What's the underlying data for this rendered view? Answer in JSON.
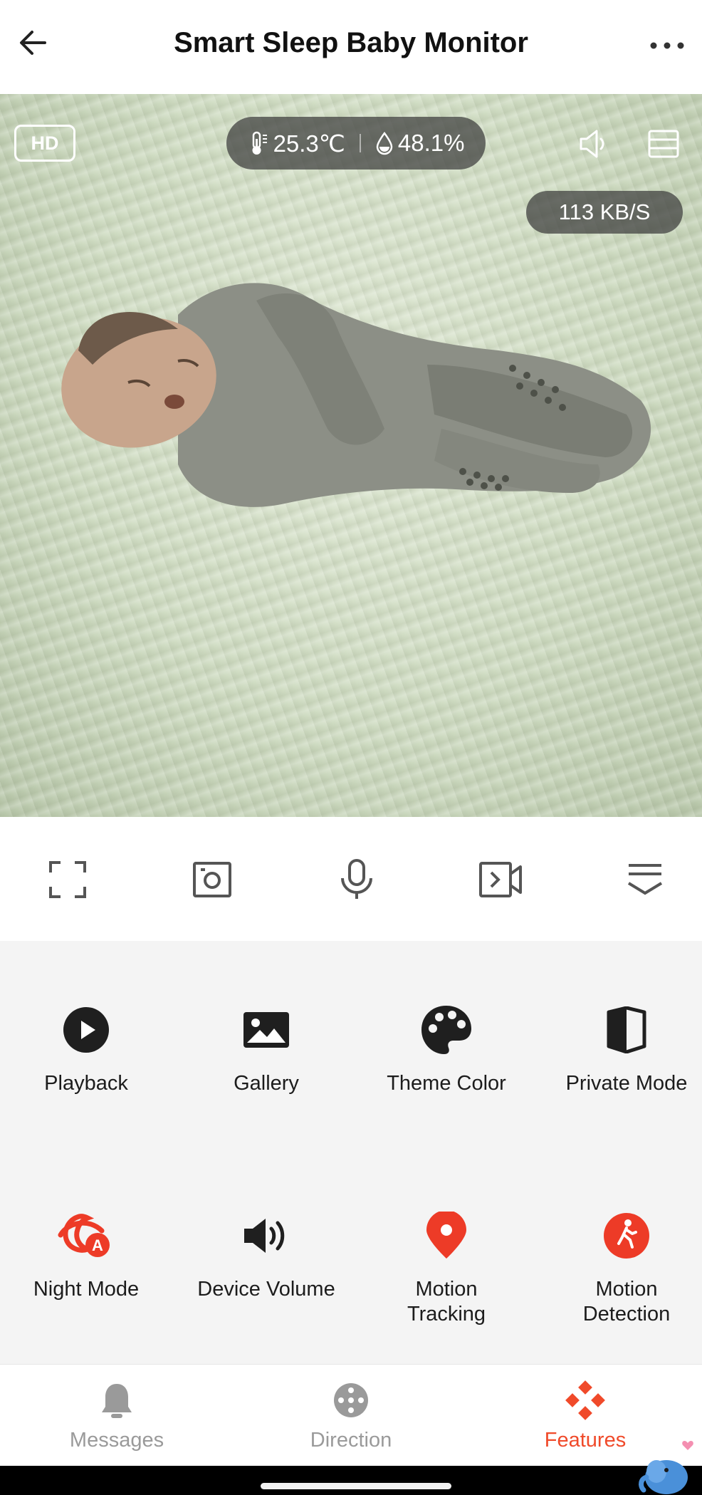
{
  "header": {
    "title": "Smart Sleep Baby Monitor"
  },
  "video": {
    "quality": "HD",
    "temperature": "25.3℃",
    "humidity": "48.1%",
    "bitrate": "113 KB/S"
  },
  "controls": [
    {
      "name": "fullscreen-icon"
    },
    {
      "name": "snapshot-icon"
    },
    {
      "name": "microphone-icon"
    },
    {
      "name": "record-icon"
    },
    {
      "name": "collapse-icon"
    }
  ],
  "features": [
    {
      "label": "Playback",
      "icon": "play-circle-icon"
    },
    {
      "label": "Gallery",
      "icon": "image-icon"
    },
    {
      "label": "Theme Color",
      "icon": "palette-icon"
    },
    {
      "label": "Private Mode",
      "icon": "shield-half-icon"
    },
    {
      "label": "Night Mode",
      "icon": "night-auto-icon"
    },
    {
      "label": "Device Volume",
      "icon": "volume-icon"
    },
    {
      "label": "Motion\nTracking",
      "icon": "location-pin-icon"
    },
    {
      "label": "Motion\nDetection",
      "icon": "walking-person-icon"
    }
  ],
  "nav": {
    "messages": "Messages",
    "direction": "Direction",
    "features": "Features",
    "active": "Features"
  },
  "colors": {
    "accent": "#f04a2a",
    "icon_dark": "#1f1f1f",
    "icon_inactive": "#9a9a9a"
  }
}
